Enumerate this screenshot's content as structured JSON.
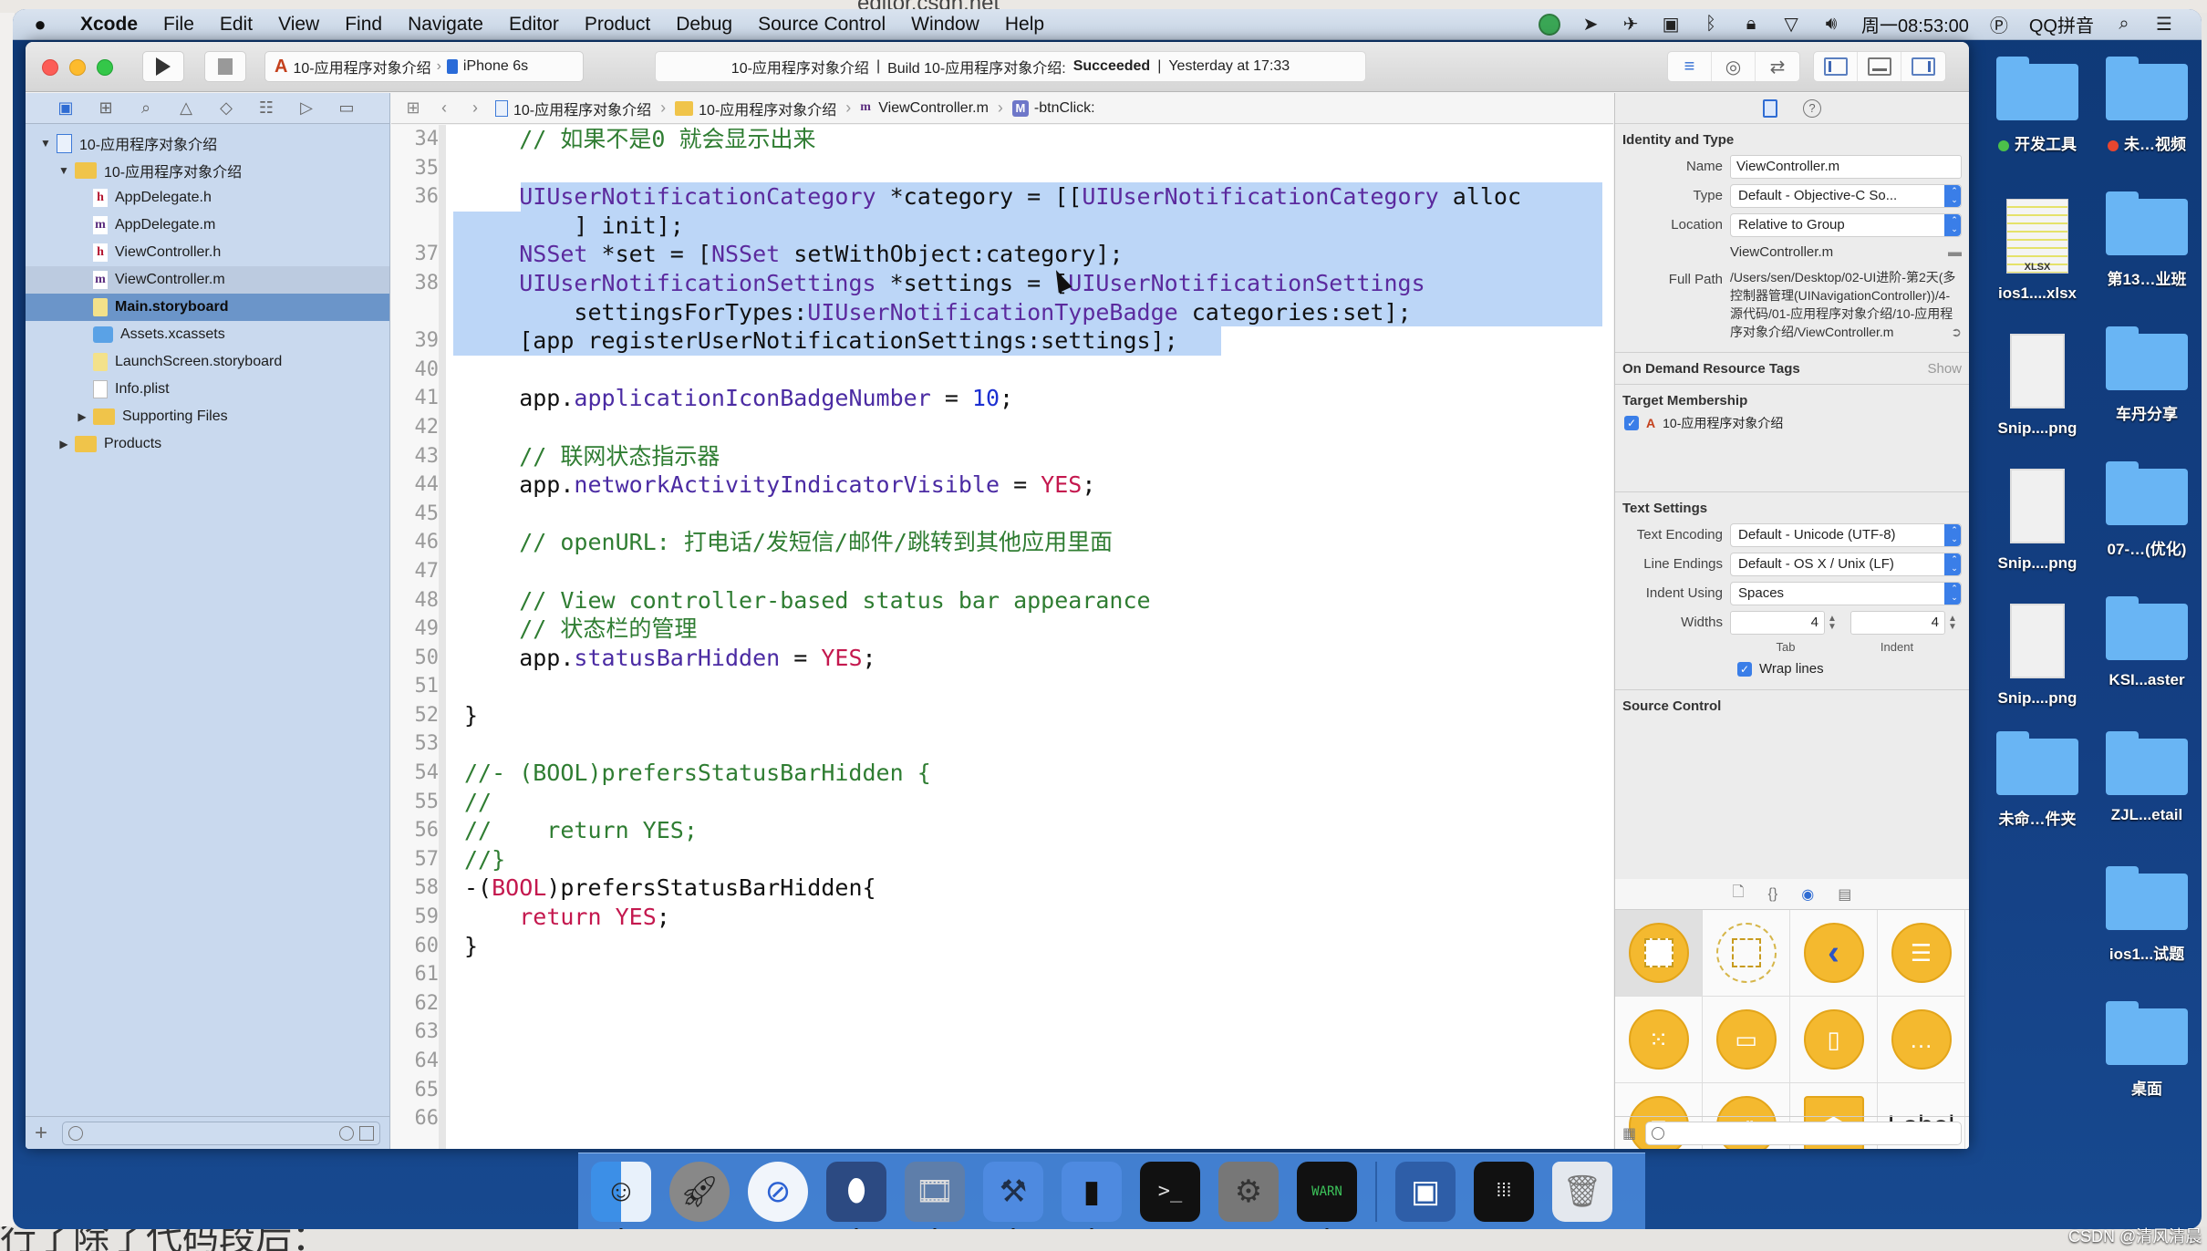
{
  "background": {
    "browser_url": "editor.csdn.net",
    "bottom_fragment": "行了除了代码段后："
  },
  "menubar": {
    "apple": "",
    "app_name": "Xcode",
    "items": [
      "File",
      "Edit",
      "View",
      "Find",
      "Navigate",
      "Editor",
      "Product",
      "Debug",
      "Source Control",
      "Window",
      "Help"
    ],
    "status": {
      "clock": "周一08:53:00",
      "input_method": "QQ拼音",
      "icons": [
        "wechat-icon",
        "location-icon",
        "airplane-icon",
        "camera-icon",
        "bluetooth-icon",
        "lock-icon",
        "wifi-icon",
        "volume-icon",
        "input-method-icon",
        "spotlight-icon",
        "notification-center-icon"
      ]
    }
  },
  "toolbar": {
    "scheme_target": "10-应用程序对象介绍",
    "scheme_device": "iPhone 6s",
    "activity": {
      "project": "10-应用程序对象介绍",
      "build_prefix": "Build 10-应用程序对象介绍:",
      "build_status": "Succeeded",
      "time": "Yesterday at 17:33"
    }
  },
  "navigator": {
    "tabs": [
      "project-navigator",
      "symbol-navigator",
      "find-navigator",
      "issue-navigator",
      "test-navigator",
      "debug-navigator",
      "breakpoint-navigator",
      "report-navigator"
    ],
    "tree": [
      {
        "label": "10-应用程序对象介绍",
        "type": "project",
        "indent": 0,
        "disclosure": "open"
      },
      {
        "label": "10-应用程序对象介绍",
        "type": "folder",
        "indent": 1,
        "disclosure": "open"
      },
      {
        "label": "AppDelegate.h",
        "type": "h",
        "indent": 2
      },
      {
        "label": "AppDelegate.m",
        "type": "m",
        "indent": 2
      },
      {
        "label": "ViewController.h",
        "type": "h",
        "indent": 2
      },
      {
        "label": "ViewController.m",
        "type": "m",
        "indent": 2,
        "state": "secondary"
      },
      {
        "label": "Main.storyboard",
        "type": "storyboard",
        "indent": 2,
        "state": "selected"
      },
      {
        "label": "Assets.xcassets",
        "type": "assets",
        "indent": 2
      },
      {
        "label": "LaunchScreen.storyboard",
        "type": "storyboard",
        "indent": 2
      },
      {
        "label": "Info.plist",
        "type": "plist",
        "indent": 2
      },
      {
        "label": "Supporting Files",
        "type": "folder",
        "indent": 2,
        "disclosure": "closed"
      },
      {
        "label": "Products",
        "type": "folder",
        "indent": 1,
        "disclosure": "closed"
      }
    ],
    "filter_placeholder": ""
  },
  "jumpbar": {
    "crumbs": [
      {
        "label": "10-应用程序对象介绍",
        "icon": "project"
      },
      {
        "label": "10-应用程序对象介绍",
        "icon": "folder"
      },
      {
        "label": "ViewController.m",
        "icon": "m"
      },
      {
        "label": "-btnClick:",
        "icon": "method"
      }
    ]
  },
  "editor": {
    "lines": [
      {
        "n": "34",
        "tokens": [
          [
            "    ",
            "pln"
          ],
          [
            "// 如果不是0 就会显示出来",
            "com"
          ]
        ]
      },
      {
        "n": "35",
        "tokens": []
      },
      {
        "n": "36",
        "sel": "first",
        "tokens": [
          [
            "    ",
            "pln"
          ],
          [
            "UIUserNotificationCategory",
            "cls"
          ],
          [
            " *category = [[",
            "pln"
          ],
          [
            "UIUserNotificationCategory",
            "cls"
          ],
          [
            " alloc",
            "pln"
          ]
        ]
      },
      {
        "n": "",
        "sel": "mid",
        "tokens": [
          [
            "        ] init];",
            "pln"
          ]
        ]
      },
      {
        "n": "37",
        "sel": "mid",
        "tokens": [
          [
            "    ",
            "pln"
          ],
          [
            "NSSet",
            "cls"
          ],
          [
            " *set = [",
            "pln"
          ],
          [
            "NSSet",
            "cls"
          ],
          [
            " setWithObject:category];",
            "pln"
          ]
        ]
      },
      {
        "n": "38",
        "sel": "mid",
        "tokens": [
          [
            "    ",
            "pln"
          ],
          [
            "UIUserNotificationSettings",
            "cls"
          ],
          [
            " *settings = [",
            "pln"
          ],
          [
            "UIUserNotificationSettings",
            "cls"
          ]
        ]
      },
      {
        "n": "",
        "sel": "mid",
        "tokens": [
          [
            "        settingsForTypes:",
            "pln"
          ],
          [
            "UIUserNotificationTypeBadge",
            "cls"
          ],
          [
            " categories:set];",
            "pln"
          ]
        ]
      },
      {
        "n": "39",
        "sel": "last",
        "tokens": [
          [
            "    [app registerUserNotificationSettings:settings];",
            "pln"
          ]
        ]
      },
      {
        "n": "40",
        "tokens": []
      },
      {
        "n": "41",
        "tokens": [
          [
            "    app.",
            "pln"
          ],
          [
            "applicationIconBadgeNumber",
            "prop"
          ],
          [
            " = ",
            "pln"
          ],
          [
            "10",
            "num"
          ],
          [
            ";",
            "pln"
          ]
        ]
      },
      {
        "n": "42",
        "tokens": []
      },
      {
        "n": "43",
        "tokens": [
          [
            "    ",
            "pln"
          ],
          [
            "// 联网状态指示器",
            "com"
          ]
        ]
      },
      {
        "n": "44",
        "tokens": [
          [
            "    app.",
            "pln"
          ],
          [
            "networkActivityIndicatorVisible",
            "prop"
          ],
          [
            " = ",
            "pln"
          ],
          [
            "YES",
            "kw"
          ],
          [
            ";",
            "pln"
          ]
        ]
      },
      {
        "n": "45",
        "tokens": []
      },
      {
        "n": "46",
        "tokens": [
          [
            "    ",
            "pln"
          ],
          [
            "// openURL: 打电话/发短信/邮件/跳转到其他应用里面",
            "com"
          ]
        ]
      },
      {
        "n": "47",
        "tokens": []
      },
      {
        "n": "48",
        "tokens": [
          [
            "    ",
            "pln"
          ],
          [
            "// View controller-based status bar appearance",
            "com"
          ]
        ]
      },
      {
        "n": "49",
        "tokens": [
          [
            "    ",
            "pln"
          ],
          [
            "// 状态栏的管理",
            "com"
          ]
        ]
      },
      {
        "n": "50",
        "tokens": [
          [
            "    app.",
            "pln"
          ],
          [
            "statusBarHidden",
            "prop"
          ],
          [
            " = ",
            "pln"
          ],
          [
            "YES",
            "kw"
          ],
          [
            ";",
            "pln"
          ]
        ]
      },
      {
        "n": "51",
        "tokens": []
      },
      {
        "n": "52",
        "tokens": [
          [
            "}",
            "pln"
          ]
        ]
      },
      {
        "n": "53",
        "tokens": []
      },
      {
        "n": "54",
        "tokens": [
          [
            "//- (BOOL)prefersStatusBarHidden {",
            "com"
          ]
        ]
      },
      {
        "n": "55",
        "tokens": [
          [
            "//",
            "com"
          ]
        ]
      },
      {
        "n": "56",
        "tokens": [
          [
            "//    return YES;",
            "com"
          ]
        ]
      },
      {
        "n": "57",
        "tokens": [
          [
            "//}",
            "com"
          ]
        ]
      },
      {
        "n": "58",
        "tokens": [
          [
            "-(",
            "pln"
          ],
          [
            "BOOL",
            "kw"
          ],
          [
            ")prefersStatusBarHidden{",
            "pln"
          ]
        ]
      },
      {
        "n": "59",
        "tokens": [
          [
            "    ",
            "pln"
          ],
          [
            "return",
            "kw"
          ],
          [
            " ",
            "pln"
          ],
          [
            "YES",
            "kw"
          ],
          [
            ";",
            "pln"
          ]
        ]
      },
      {
        "n": "60",
        "tokens": [
          [
            "}",
            "pln"
          ]
        ]
      },
      {
        "n": "61",
        "tokens": []
      },
      {
        "n": "62",
        "tokens": []
      },
      {
        "n": "63",
        "tokens": []
      },
      {
        "n": "64",
        "tokens": []
      },
      {
        "n": "65",
        "tokens": []
      },
      {
        "n": "66",
        "tokens": []
      }
    ]
  },
  "inspector": {
    "identity": {
      "title": "Identity and Type",
      "name_label": "Name",
      "name_value": "ViewController.m",
      "type_label": "Type",
      "type_value": "Default - Objective-C So...",
      "location_label": "Location",
      "location_value": "Relative to Group",
      "relative_file": "ViewController.m",
      "fullpath_label": "Full Path",
      "fullpath_value": "/Users/sen/Desktop/02-UI进阶-第2天(多控制器管理(UINavigationController))/4-源代码/01-应用程序对象介绍/10-应用程序对象介绍/ViewController.m"
    },
    "odr": {
      "title": "On Demand Resource Tags",
      "show": "Show"
    },
    "target": {
      "title": "Target Membership",
      "item": "10-应用程序对象介绍",
      "checked": true
    },
    "text_settings": {
      "title": "Text Settings",
      "encoding_label": "Text Encoding",
      "encoding_value": "Default - Unicode (UTF-8)",
      "endings_label": "Line Endings",
      "endings_value": "Default - OS X / Unix (LF)",
      "indent_label": "Indent Using",
      "indent_value": "Spaces",
      "widths_label": "Widths",
      "tab_value": "4",
      "indent_width_value": "4",
      "tab_label": "Tab",
      "indent_sub_label": "Indent",
      "wrap_label": "Wrap lines",
      "wrap_checked": true
    },
    "source_control": {
      "title": "Source Control"
    },
    "library": {
      "tabs": [
        "file-template-library",
        "code-snippet-library",
        "object-library",
        "media-library"
      ],
      "objects": [
        "view-controller",
        "storyboard-reference",
        "navigation-controller",
        "table-view-controller",
        "collection-view-controller",
        "tab-bar-controller",
        "split-view-controller",
        "page-view-controller",
        "glkit-view-controller",
        "av-player-view-controller",
        "object",
        "label"
      ],
      "label_text": "Label"
    }
  },
  "desktop": {
    "items": [
      {
        "name": "开发工具",
        "kind": "folder",
        "tag": "#4cc04a"
      },
      {
        "name": "未…视频",
        "kind": "folder",
        "tag": "#e8462f"
      },
      {
        "name": "ios1....xlsx",
        "kind": "xlsx"
      },
      {
        "name": "第13…业班",
        "kind": "folder"
      },
      {
        "name": "Snip....png",
        "kind": "image"
      },
      {
        "name": "车丹分享",
        "kind": "folder"
      },
      {
        "name": "Snip....png",
        "kind": "image"
      },
      {
        "name": "07-…(优化)",
        "kind": "folder"
      },
      {
        "name": "Snip....png",
        "kind": "image"
      },
      {
        "name": "KSI...aster",
        "kind": "folder"
      },
      {
        "name": "未命…件夹",
        "kind": "folder"
      },
      {
        "name": "ZJL...etail",
        "kind": "folder"
      },
      {
        "name": "ios1...试题",
        "kind": "folder"
      },
      {
        "name": "桌面",
        "kind": "folder"
      }
    ],
    "xlsx_badge": "XLSX"
  },
  "dock": {
    "apps": [
      {
        "name": "finder",
        "running": true
      },
      {
        "name": "launchpad",
        "running": false
      },
      {
        "name": "safari",
        "running": false
      },
      {
        "name": "mouse-app",
        "running": true
      },
      {
        "name": "video-app",
        "running": true
      },
      {
        "name": "xcode",
        "running": true
      },
      {
        "name": "simulator",
        "running": true
      },
      {
        "name": "terminal",
        "running": false
      },
      {
        "name": "system-preferences",
        "running": false
      },
      {
        "name": "console",
        "running": true
      }
    ],
    "docs": [
      "desktop-stack",
      "applications-stack",
      "trash"
    ]
  },
  "watermark": "CSDN @清风清晨"
}
